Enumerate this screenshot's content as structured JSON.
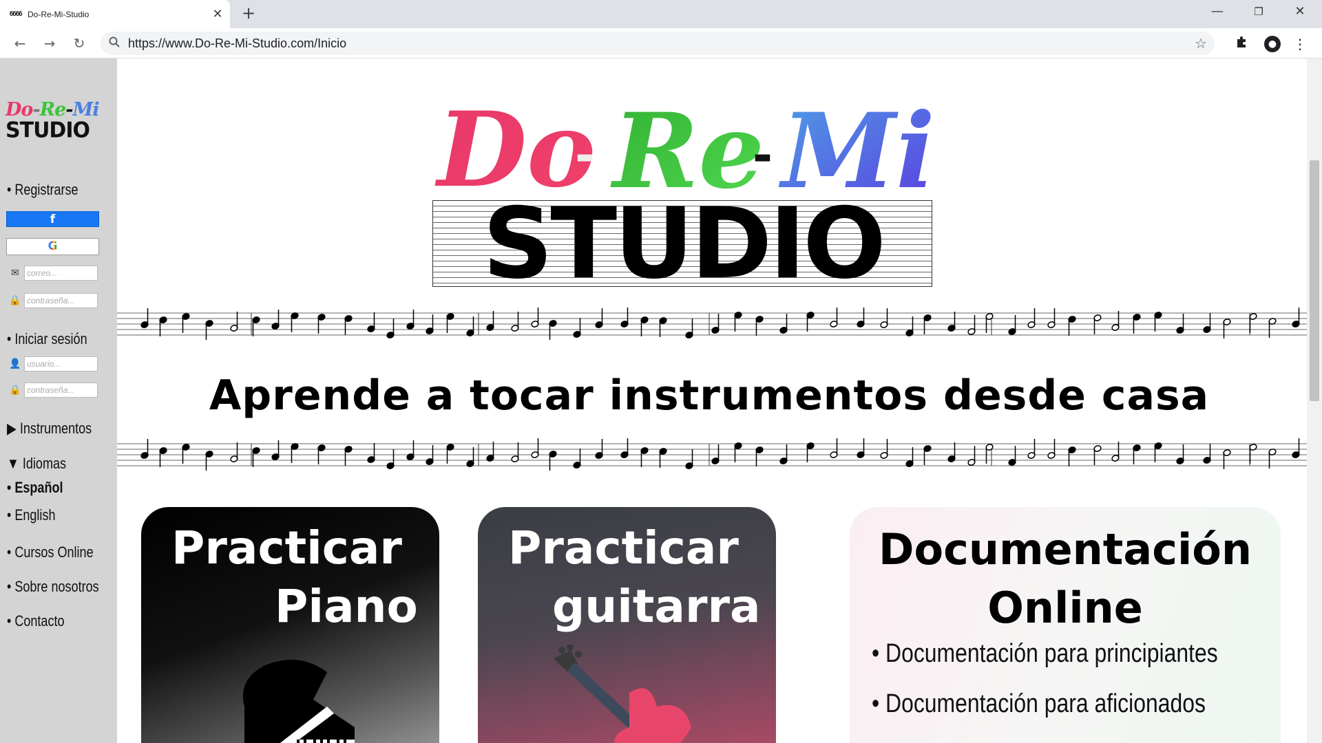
{
  "browser": {
    "tab": {
      "favicon": "бббб",
      "title": "Do-Re-Mi-Studio"
    },
    "url": "https://www.Do-Re-Mi-Studio.com/Inicio",
    "icons": {
      "back": "back-arrow-icon",
      "forward": "forward-arrow-icon",
      "reload": "reload-icon",
      "search": "search-icon",
      "bookmark": "star-icon",
      "extensions": "puzzle-icon",
      "profile": "account-icon",
      "minimize": "minimize-icon",
      "restore": "restore-icon",
      "close": "close-icon",
      "newtab": "plus-icon"
    }
  },
  "sidebar": {
    "logo": {
      "do": "Do",
      "re": "Re",
      "mi": "Mi",
      "sep": "-",
      "studio": "STUDIO"
    },
    "register": {
      "label": "• Registrarse",
      "facebook": "f",
      "google": "G",
      "email_placeholder": "correo...",
      "password_placeholder": "contraseña..."
    },
    "login": {
      "label": "• Iniciar sesión",
      "user_placeholder": "usuario...",
      "password_placeholder": "contraseña..."
    },
    "instruments": "▶ Instrumentos",
    "languages": {
      "label": "▼ Idiomas",
      "items": [
        "• Español",
        "• English"
      ]
    },
    "courses": "• Cursos Online",
    "about": "• Sobre nosotros",
    "contact": "• Contacto"
  },
  "hero": {
    "script": {
      "do": "Do",
      "re": "Re",
      "mi": "Mi",
      "sep": "-"
    },
    "studio": "STUDIO",
    "colors": {
      "do": "#e8386a",
      "re": "#3cc43c",
      "mi": "#4a7fe0"
    }
  },
  "tagline": "Aprende a tocar instrumentos desde casa",
  "cards": {
    "piano": {
      "line1": "Practicar",
      "line2": "Piano",
      "icon": "grand-piano-icon"
    },
    "guitar": {
      "line1": "Practicar",
      "line2": "guitarra",
      "icon": "electric-guitar-icon"
    },
    "docs": {
      "line1": "Documentación",
      "line2": "Online",
      "items": [
        "• Documentación para principiantes",
        "• Documentación para aficionados"
      ]
    }
  }
}
